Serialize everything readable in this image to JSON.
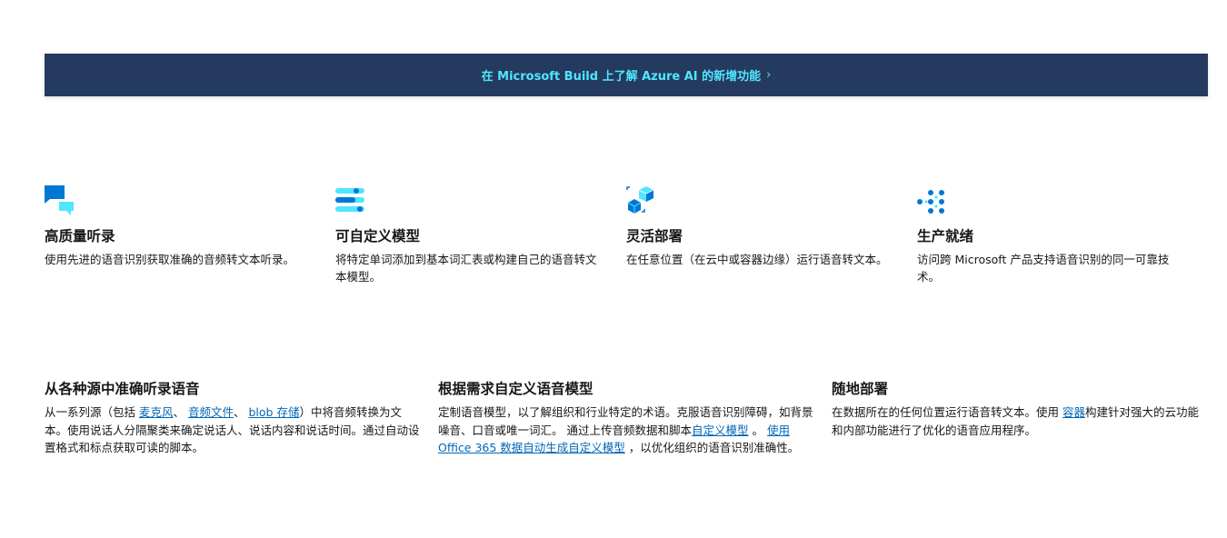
{
  "banner": {
    "text": "在 Microsoft Build 上了解 Azure AI 的新增功能",
    "chevron": "›",
    "color_bg": "#243a5e",
    "color_text": "#50e6ff"
  },
  "features": [
    {
      "icon": "chat-bubbles-icon",
      "title": "高质量听录",
      "description": "使用先进的语音识别获取准确的音频转文本听录。"
    },
    {
      "icon": "sliders-icon",
      "title": "可自定义模型",
      "description": "将特定单词添加到基本词汇表或构建自己的语音转文本模型。"
    },
    {
      "icon": "cubes-icon",
      "title": "灵活部署",
      "description": "在任意位置（在云中或容器边缘）运行语音转文本。"
    },
    {
      "icon": "dot-grid-icon",
      "title": "生产就绪",
      "description": "访问跨 Microsoft 产品支持语音识别的同一可靠技术。"
    }
  ],
  "details": [
    {
      "title": "从各种源中准确听录语音",
      "text_1": "从一系列源（包括 ",
      "link_1": "麦克风",
      "text_2": "、 ",
      "link_2": "音频文件",
      "text_3": "、 ",
      "link_3": "blob 存储",
      "text_4": "）中将音频转换为文本。使用说话人分隔聚类来确定说话人、说话内容和说话时间。通过自动设置格式和标点获取可读的脚本。"
    },
    {
      "title": "根据需求自定义语音模型",
      "text_1": "定制语音模型，以了解组织和行业特定的术语。克服语音识别障碍，如背景噪音、口音或唯一词汇。 通过上传音频数据和脚本",
      "link_1": "自定义模型",
      "text_2": " 。 ",
      "link_2": "使用 Office 365 数据自动生成自定义模型",
      "text_3": " ，以优化组织的语音识别准确性。"
    },
    {
      "title": "随地部署",
      "text_1": "在数据所在的任何位置运行语音转文本。使用 ",
      "link_1": "容器",
      "text_2": "构建针对强大的云功能和内部功能进行了优化的语音应用程序。"
    }
  ]
}
